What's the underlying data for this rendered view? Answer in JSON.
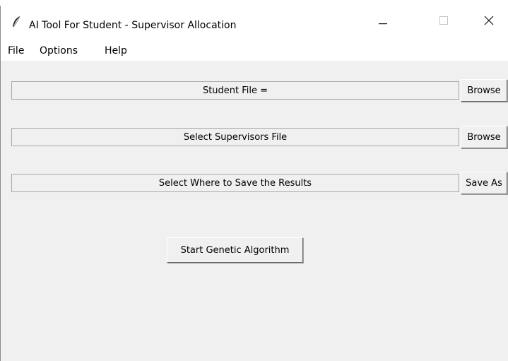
{
  "window": {
    "title": "AI Tool For Student - Supervisor Allocation",
    "app_icon": "feather-icon",
    "controls": {
      "minimize": "minimize-icon",
      "maximize": "maximize-icon",
      "close": "close-icon"
    }
  },
  "menubar": {
    "items": [
      "File",
      "Options",
      "Help"
    ]
  },
  "fields": {
    "student": {
      "text": "Student File =",
      "button": "Browse"
    },
    "supervisors": {
      "text": "Select Supervisors File",
      "button": "Browse"
    },
    "save": {
      "text": "Select Where to Save the Results",
      "button": "Save As"
    }
  },
  "actions": {
    "start": "Start Genetic Algorithm"
  }
}
